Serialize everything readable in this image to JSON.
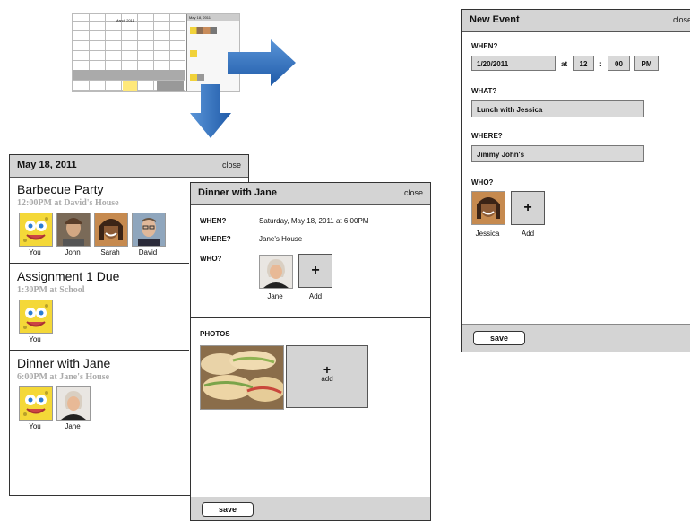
{
  "calendar_thumb": {
    "month": "March 2011",
    "side_date": "May 18, 2011"
  },
  "day_panel": {
    "title": "May 18, 2011",
    "close": "close",
    "events": [
      {
        "title": "Barbecue Party",
        "time": "12:00PM at David's House",
        "people": [
          "You",
          "John",
          "Sarah",
          "David"
        ]
      },
      {
        "title": "Assignment 1 Due",
        "time": "1:30PM at School",
        "people": [
          "You"
        ]
      },
      {
        "title": "Dinner with Jane",
        "time": "6:00PM at Jane's House",
        "people": [
          "You",
          "Jane"
        ]
      }
    ]
  },
  "detail_panel": {
    "title": "Dinner with Jane",
    "close": "close",
    "when_label": "WHEN?",
    "when_value": "Saturday, May 18, 2011 at 6:00PM",
    "where_label": "WHERE?",
    "where_value": "Jane's House",
    "who_label": "WHO?",
    "who": [
      "Jane"
    ],
    "add_label": "Add",
    "photos_label": "PHOTOS",
    "photo_add": "add",
    "save": "save"
  },
  "new_event": {
    "title": "New Event",
    "close": "close",
    "when_label": "WHEN?",
    "date": "1/20/2011",
    "at": "at",
    "hour": "12",
    "colon": ":",
    "minute": "00",
    "ampm": "PM",
    "what_label": "WHAT?",
    "what_value": "Lunch with Jessica",
    "where_label": "WHERE?",
    "where_value": "Jimmy John's",
    "who_label": "WHO?",
    "who": [
      "Jessica"
    ],
    "add_label": "Add",
    "save": "save"
  },
  "icons": {
    "plus": "+"
  },
  "colors": {
    "arrow": "#2f6fbd",
    "header": "#d4d4d4"
  }
}
